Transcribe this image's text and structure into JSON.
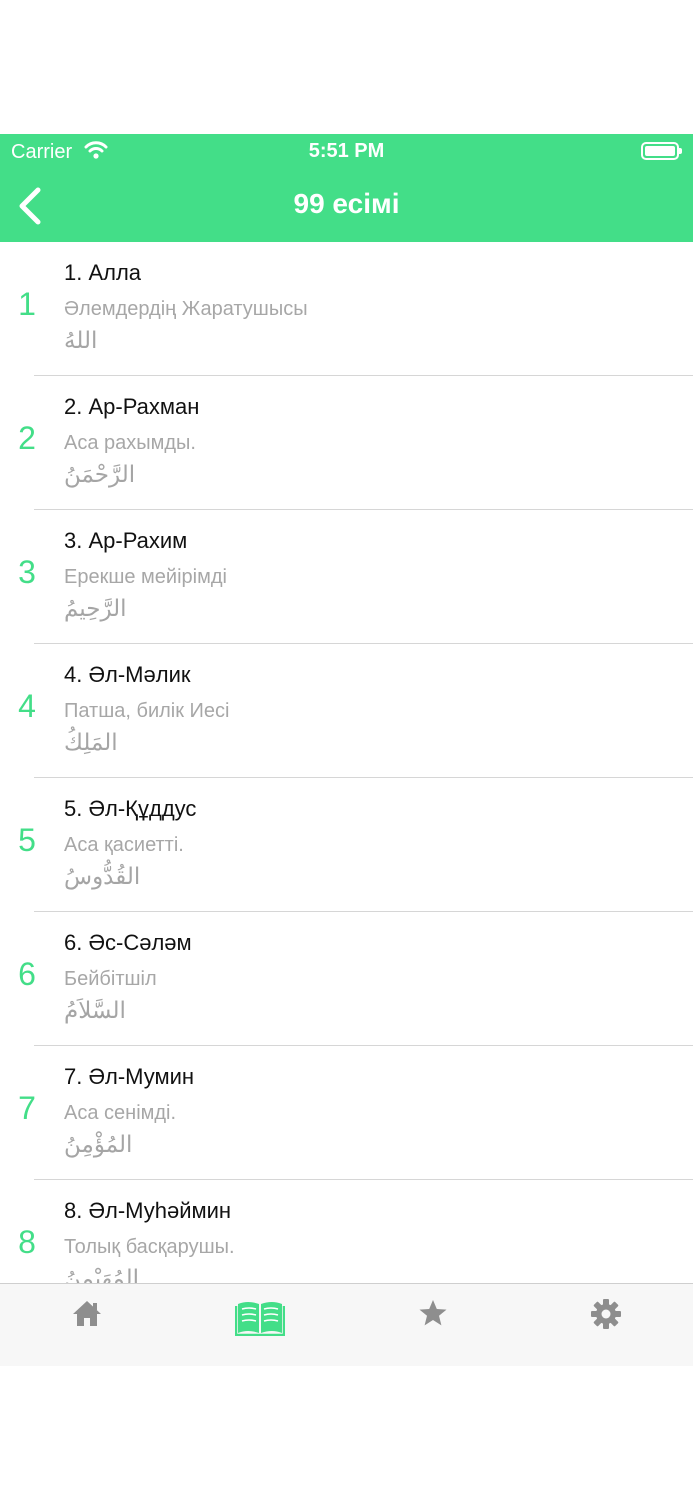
{
  "status_bar": {
    "carrier": "Carrier",
    "time": "5:51 PM"
  },
  "nav": {
    "title": "99 есімі"
  },
  "names": [
    {
      "number": "1",
      "title": "1. Алла",
      "meaning": "Әлемдердің Жаратушысы",
      "arabic": "اللهُ"
    },
    {
      "number": "2",
      "title": "2. Ар-Рахман",
      "meaning": "Аса рахымды.",
      "arabic": "الرَّحْمَنُ"
    },
    {
      "number": "3",
      "title": "3. Ар-Рахим",
      "meaning": "Ерекше мейірімді",
      "arabic": "الرَّحِيمُ"
    },
    {
      "number": "4",
      "title": "4. Әл-Мәлик",
      "meaning": "Патша, билік Иесі",
      "arabic": "المَلِكُ"
    },
    {
      "number": "5",
      "title": "5. Әл-Құддус",
      "meaning": "Аса қасиетті.",
      "arabic": "القُدُّوسُ"
    },
    {
      "number": "6",
      "title": "6. Әс-Сәләм",
      "meaning": "Бейбітшіл",
      "arabic": "السَّلاَمُ"
    },
    {
      "number": "7",
      "title": "7. Әл-Мумин",
      "meaning": "Аса сенімді.",
      "arabic": "المُؤْمِنُ"
    },
    {
      "number": "8",
      "title": "8. Әл-Муһәймин",
      "meaning": "Толық басқарушы.",
      "arabic": "المُهَيْمِنُ"
    }
  ],
  "tabs": [
    {
      "icon": "home-icon",
      "active": false
    },
    {
      "icon": "book-open-icon",
      "active": true
    },
    {
      "icon": "star-icon",
      "active": false
    },
    {
      "icon": "gear-icon",
      "active": false
    }
  ],
  "colors": {
    "accent": "#43DE88",
    "tab_inactive": "#8e8e8e",
    "subtitle": "#a7a7a7"
  }
}
